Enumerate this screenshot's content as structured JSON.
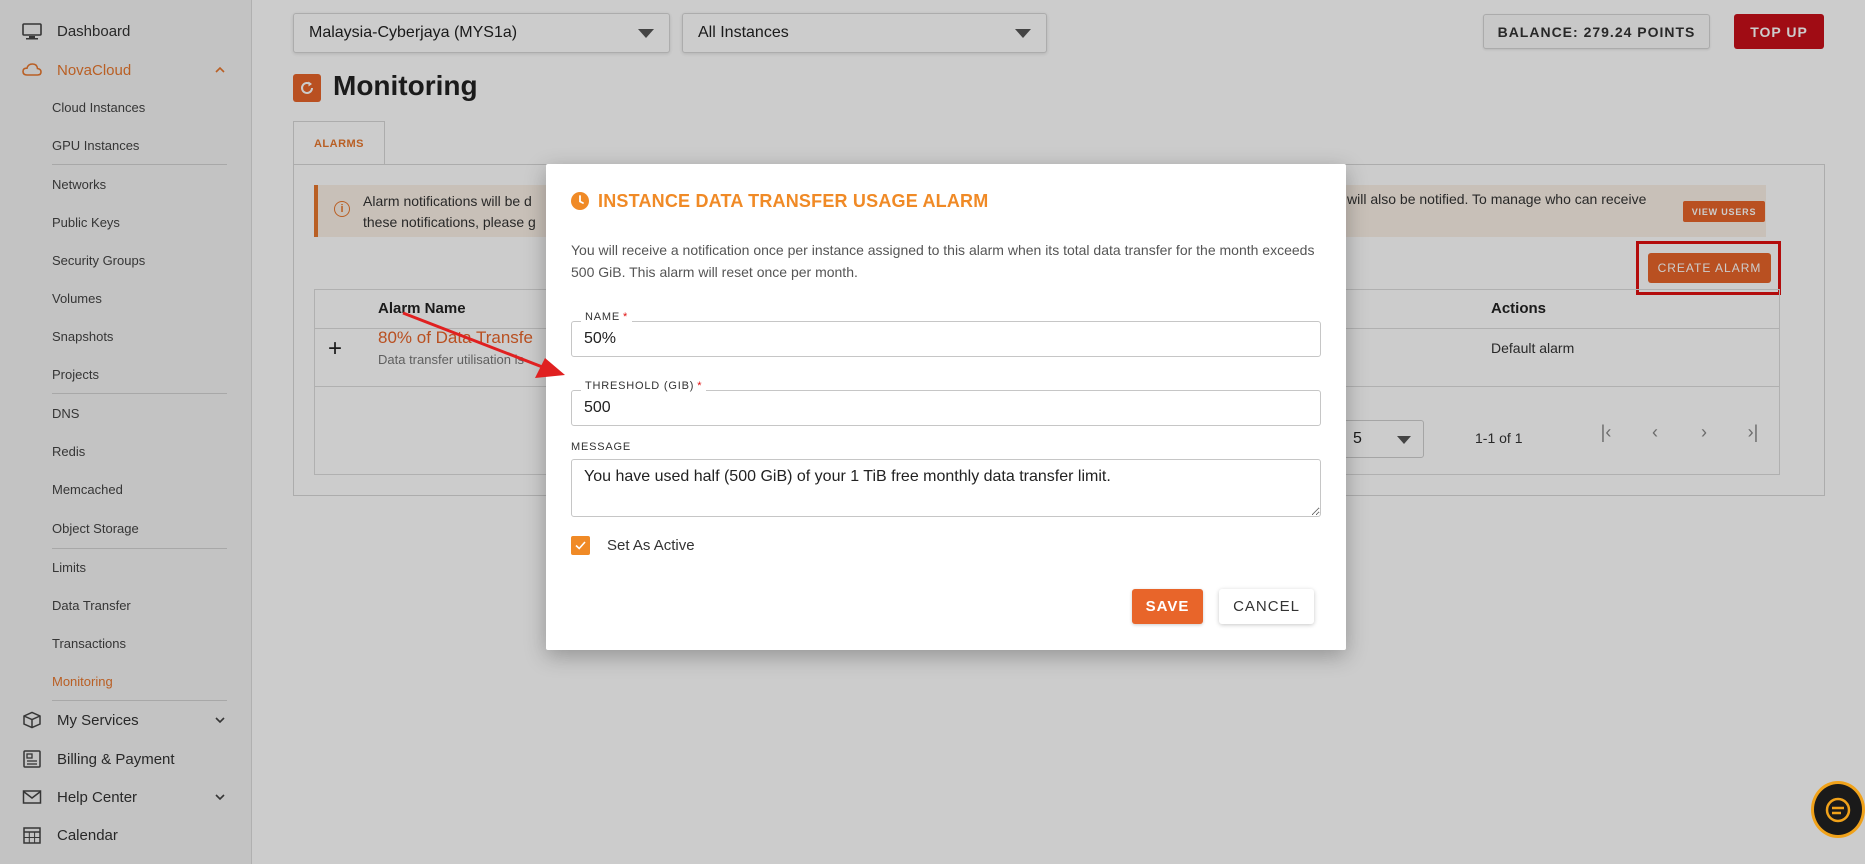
{
  "sidebar": {
    "dashboard": "Dashboard",
    "novacloud": "NovaCloud",
    "items": [
      "Cloud Instances",
      "GPU Instances",
      "Networks",
      "Public Keys",
      "Security Groups",
      "Volumes",
      "Snapshots",
      "Projects",
      "DNS",
      "Redis",
      "Memcached",
      "Object Storage",
      "Limits",
      "Data Transfer",
      "Transactions",
      "Monitoring"
    ],
    "my_services": "My Services",
    "billing": "Billing & Payment",
    "help_center": "Help Center",
    "calendar": "Calendar",
    "active_item": "Monitoring"
  },
  "header": {
    "region": "Malaysia-Cyberjaya (MYS1a)",
    "instances_filter": "All Instances",
    "balance": "BALANCE: 279.24 POINTS",
    "topup": "TOP UP"
  },
  "page": {
    "title": "Monitoring",
    "tab": "ALARMS",
    "banner_left": "Alarm notifications will be d",
    "banner_left_2": "these notifications, please g",
    "banner_right": "will also be notified. To manage who can receive",
    "view_users": "VIEW USERS",
    "create_alarm": "CREATE ALARM",
    "table": {
      "col_alarm_name": "Alarm Name",
      "col_actions": "Actions",
      "row_name": "80% of Data Transfe",
      "row_desc": "Data transfer utilisation is",
      "row_action": "Default alarm",
      "rows_per_page": "5",
      "page_info": "1-1 of 1"
    }
  },
  "modal": {
    "title": "INSTANCE DATA TRANSFER USAGE ALARM",
    "description": "You will receive a notification once per instance assigned to this alarm when its total data transfer for the month exceeds 500 GiB. This alarm will reset once per month.",
    "name_label": "NAME",
    "name_value": "50%",
    "threshold_label": "THRESHOLD (GIB)",
    "threshold_value": "500",
    "message_label": "MESSAGE",
    "message_value": "You have used half (500 GiB) of your 1 TiB free monthly data transfer limit.",
    "set_active_label": "Set As Active",
    "set_active": true,
    "save": "SAVE",
    "cancel": "CANCEL"
  },
  "colors": {
    "accent": "#e8652a",
    "alarm_title": "#f08a26",
    "topup": "#c8101a",
    "highlight": "#e01010"
  },
  "icons": [
    "monitor-icon",
    "cloud-icon",
    "box-icon",
    "billing-icon",
    "mail-icon",
    "calendar-icon",
    "refresh-icon",
    "info-icon",
    "clock-icon",
    "check-icon",
    "chat-icon"
  ]
}
